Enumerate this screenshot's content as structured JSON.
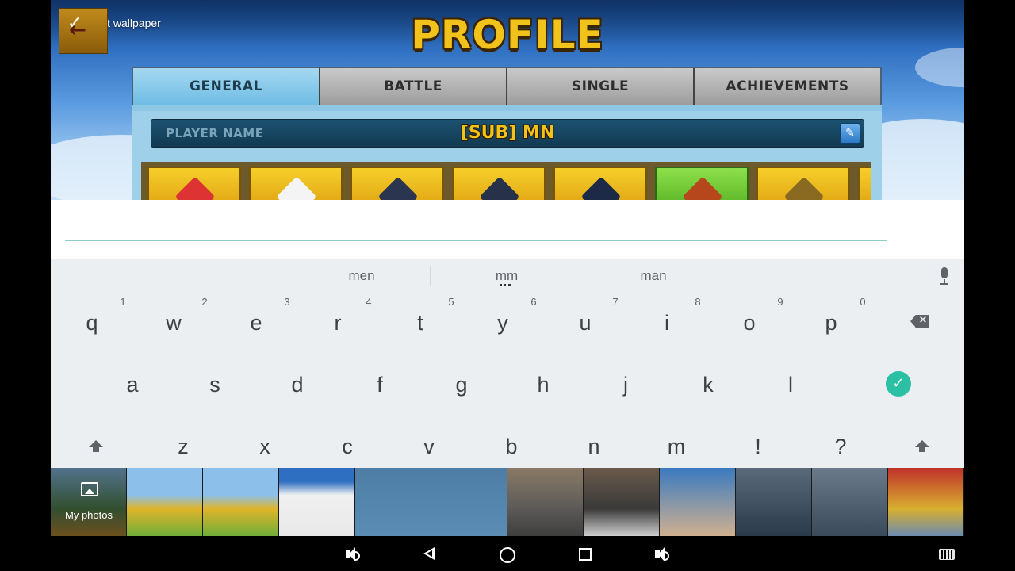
{
  "game": {
    "set_wallpaper_label": "Set wallpaper",
    "title": "PROFILE",
    "tabs": [
      "GENERAL",
      "BATTLE",
      "SINGLE",
      "ACHIEVEMENTS"
    ],
    "active_tab": "GENERAL",
    "player_name_label": "PLAYER NAME",
    "player_name_value": "[SUB] MN"
  },
  "keyboard": {
    "suggestions": [
      "men",
      "mm",
      "man"
    ],
    "row1": [
      "q",
      "w",
      "e",
      "r",
      "t",
      "y",
      "u",
      "i",
      "o",
      "p"
    ],
    "row1_hints": [
      "1",
      "2",
      "3",
      "4",
      "5",
      "6",
      "7",
      "8",
      "9",
      "0"
    ],
    "row2": [
      "a",
      "s",
      "d",
      "f",
      "g",
      "h",
      "j",
      "k",
      "l"
    ],
    "row3": [
      "z",
      "x",
      "c",
      "v",
      "b",
      "n",
      "m",
      "!",
      "?"
    ],
    "accent_color": "#2bbfa4"
  },
  "photo_strip": {
    "my_photos_label": "My photos"
  },
  "navbar": {
    "icons": [
      "volume-down-icon",
      "back-icon",
      "home-icon",
      "recents-icon",
      "volume-up-icon",
      "keyboard-icon"
    ]
  }
}
